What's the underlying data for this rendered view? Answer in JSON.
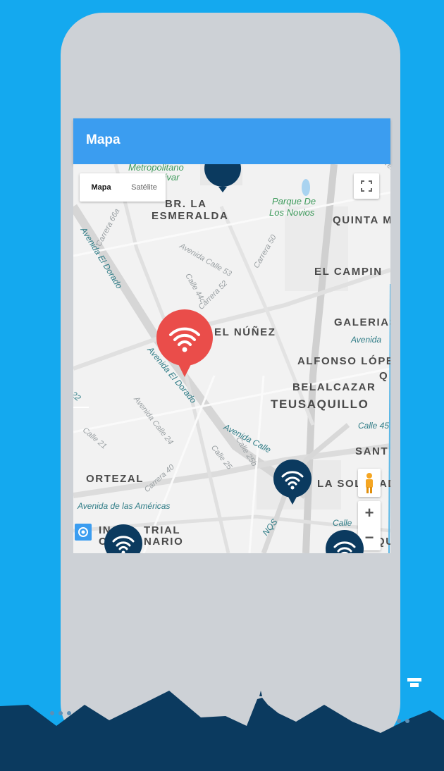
{
  "appbar": {
    "title": "Mapa"
  },
  "map": {
    "map_type_options": [
      "Mapa",
      "Satélite"
    ],
    "neighborhoods": [
      "BR. LA",
      "ESMERALDA",
      "QUINTA M",
      "EL CAMPIN",
      "EL NÚÑEZ",
      "GALERIAS",
      "ALFONSO LÓPE",
      "Q",
      "BELALCAZAR",
      "TEUSAQUILLO",
      "SANT",
      "ORTEZAL",
      "LA SOL",
      "AD",
      "IN",
      "TRIAL",
      "C",
      "NARIO",
      "QU"
    ],
    "streets": [
      "Avenida El Dorado",
      "Carrera 66a",
      "Avenida Calle 53",
      "Carrera 50",
      "Calle 44c",
      "Carrera 52",
      "Avenida El Dorado",
      "Avenida Calle 24",
      "Avenida Calle",
      "Calle 25b",
      "Calle 25",
      "Calle 21",
      "Carrera 40",
      "Avenida de las Américas",
      "NQS",
      "Calle 45",
      "Avenida",
      "Calle",
      "le 22",
      "Carrera 60"
    ],
    "parks": [
      "Metropolitano",
      "Bolívar",
      "Parque De",
      "Los Novios"
    ],
    "colors": {
      "selected_marker": "#ea4d4a",
      "marker": "#0b3a5f",
      "accent": "#3b9df0",
      "background": "#14a9ef"
    }
  },
  "icons": [
    "wifi-icon",
    "fullscreen-icon",
    "pegman-icon",
    "my-location-icon"
  ]
}
